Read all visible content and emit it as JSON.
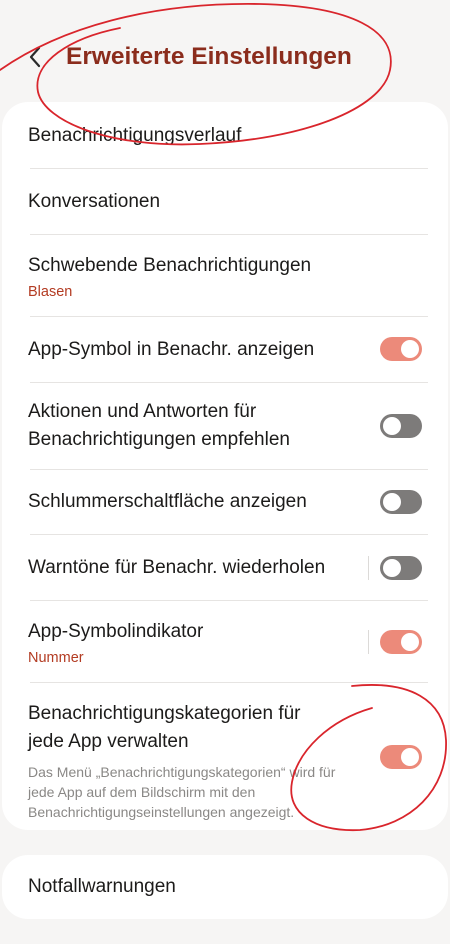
{
  "header": {
    "title": "Erweiterte Einstellungen"
  },
  "settings": {
    "items": [
      {
        "label": "Benachrichtigungsverlauf"
      },
      {
        "label": "Konversationen"
      },
      {
        "label": "Schwebende Benachrichtigungen",
        "sub": "Blasen"
      },
      {
        "label": "App-Symbol in Benachr. anzeigen",
        "toggle": "on"
      },
      {
        "label_line1": "Aktionen und Antworten für",
        "label_line2": "Benachrichtigungen empfehlen",
        "toggle": "off"
      },
      {
        "label": "Schlummerschaltfläche anzeigen",
        "toggle": "off"
      },
      {
        "label": "Warntöne für Benachr. wiederholen",
        "toggle": "off"
      },
      {
        "label": "App-Symbolindikator",
        "sub": "Nummer",
        "toggle": "on"
      },
      {
        "label_line1": "Benachrichtigungskategorien für",
        "label_line2": "jede App verwalten",
        "desc": "Das Menü „Benachrichtigungskategorien“ wird für jede App auf dem Bildschirm mit den Benachrichtigungseinstellungen angezeigt.",
        "toggle": "on"
      }
    ]
  },
  "emergency": {
    "label": "Notfallwarnungen"
  },
  "colors": {
    "title": "#8b2c1c",
    "subtext": "#b33b22",
    "toggle_on": "#ec8a7a",
    "toggle_off": "#7d7b7a",
    "annotation": "#d9252c"
  }
}
